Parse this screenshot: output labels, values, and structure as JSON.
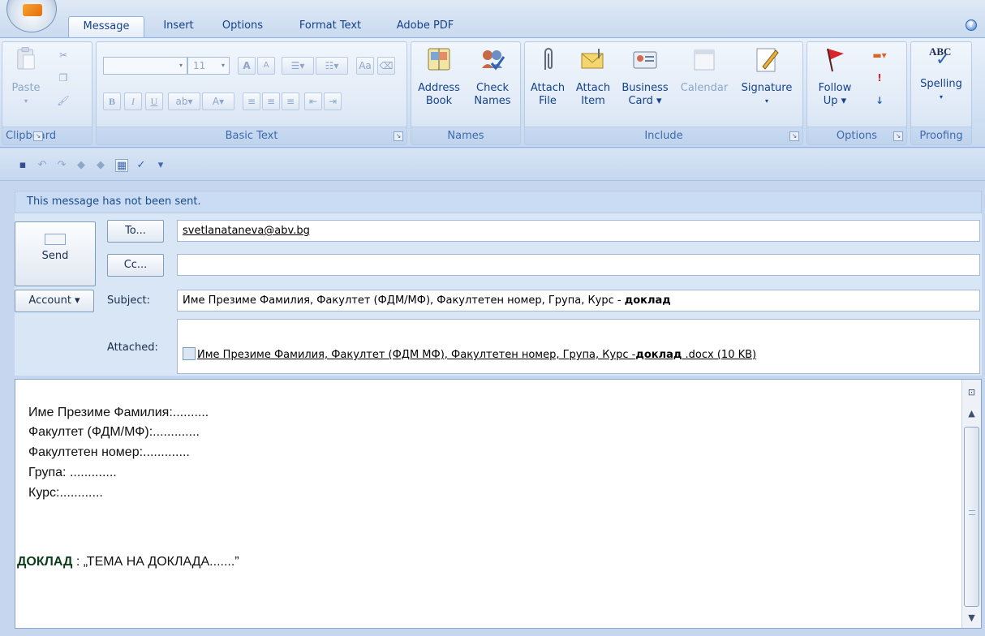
{
  "ribbon_tabs": [
    "Message",
    "Insert",
    "Options",
    "Format Text",
    "Adobe PDF"
  ],
  "help_label": "?",
  "clipboard": {
    "paste": "Paste",
    "group": "Clipboard"
  },
  "basic_text": {
    "font_size": "11",
    "bold": "B",
    "italic": "I",
    "underline": "U",
    "grow_font": "A",
    "shrink_font": "A",
    "group": "Basic Text"
  },
  "names": {
    "address_book": [
      "Address",
      "Book"
    ],
    "check_names": [
      "Check",
      "Names"
    ],
    "group": "Names"
  },
  "include": {
    "attach_file": [
      "Attach",
      "File"
    ],
    "attach_item": [
      "Attach",
      "Item"
    ],
    "business_card": [
      "Business",
      "Card ▾"
    ],
    "calendar": "Calendar",
    "signature": "Signature",
    "group": "Include"
  },
  "options": {
    "follow_up": [
      "Follow",
      "Up ▾"
    ],
    "group": "Options"
  },
  "proofing": {
    "spelling": "Spelling",
    "abc": "ABC",
    "group": "Proofing"
  },
  "message": {
    "info": "This message has not been sent.",
    "send_label": "Send",
    "to_button": "To...",
    "cc_button": "Cc...",
    "account_button": "Account ▾",
    "subject_label": "Subject:",
    "attached_label": "Attached:",
    "to_value": "svetlanataneva@abv.bg",
    "cc_value": "",
    "subject_value": "Име Презиме Фамилия, Факултет (ФДМ/МФ), Факултетен номер, Група, Курс - ",
    "subject_value_bold": "доклад",
    "attachment_name_prefix": "Име Презиме Фамилия, Факултет (ФДМ МФ), Факултетен номер, Група, Курс -",
    "attachment_name_bold": "доклад",
    "attachment_name_suffix": " .docx (10 KB)"
  },
  "body": {
    "lines": [
      "Име Презиме Фамилия:..........",
      "Факултет (ФДМ/МФ):.............",
      "Факултетен номер:.............",
      "Група: .............",
      "Курс:............"
    ],
    "report_label": "ДОКЛАД",
    "report_text": " : „ТЕМА НА ДОКЛАДА.......”"
  },
  "colors": {
    "accent": "#15428b",
    "ribbon_bg": "#dfe9f5",
    "flag_red": "#d8262b"
  }
}
